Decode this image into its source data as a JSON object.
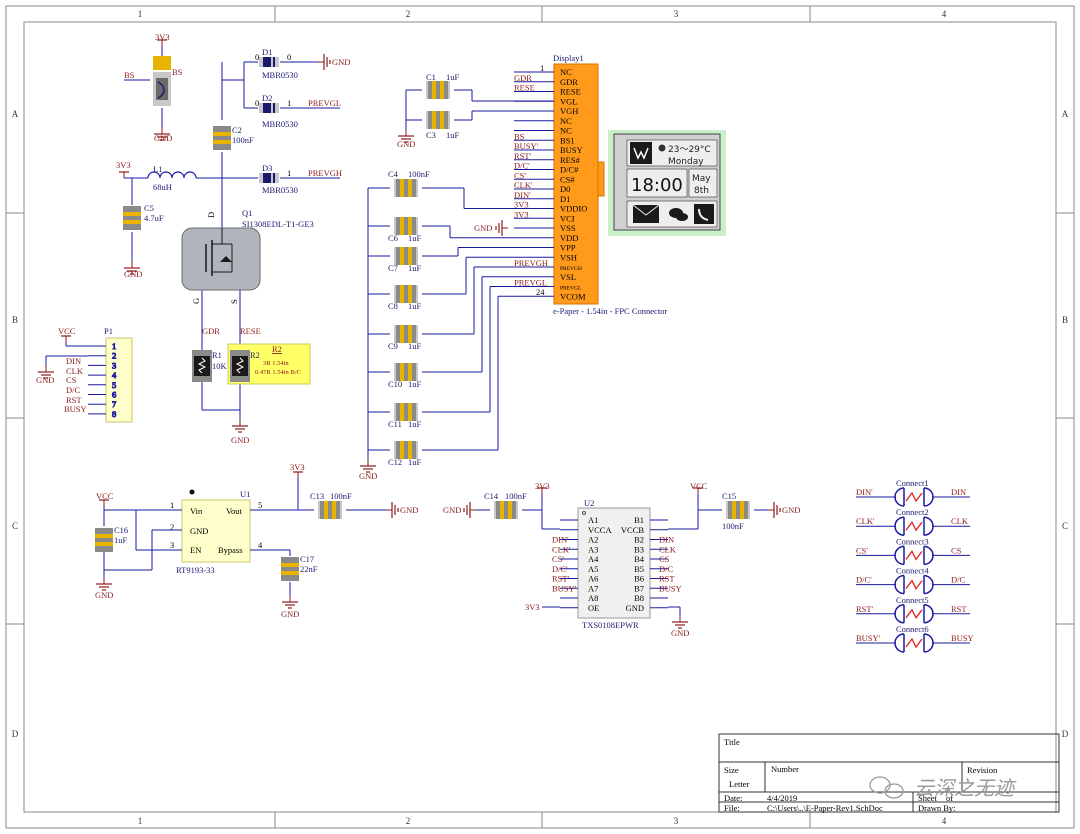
{
  "frame": {
    "cols": [
      "1",
      "2",
      "3",
      "4"
    ],
    "rows": [
      "A",
      "B",
      "C",
      "D"
    ]
  },
  "title_block": {
    "title_label": "Title",
    "size_label": "Size",
    "size_value": "Letter",
    "number_label": "Number",
    "revision_label": "Revision",
    "date_label": "Date:",
    "date_value": "4/4/2019",
    "file_label": "File:",
    "file_value": "C:\\Users\\..\\E-Paper-Rev1.SchDoc",
    "sheet_label": "Sheet",
    "of_label": "of",
    "drawn_label": "Drawn By:"
  },
  "watermark": "云深之无迹",
  "nets": {
    "v3v3": "3V3",
    "gnd": "GND",
    "vcc": "VCC",
    "bs": "BS",
    "prevgl": "PREVGL",
    "prevgh": "PREVGH",
    "gdr": "GDR",
    "rese": "RESE",
    "din": "DIN",
    "clk": "CLK",
    "cs": "CS",
    "dc": "D/C",
    "rst": "RST",
    "busy": "BUSY",
    "din_p": "DIN'",
    "clk_p": "CLK'",
    "cs_p": "CS'",
    "dc_p": "D/C'",
    "rst_p": "RST'",
    "busy_p": "BUSY'"
  },
  "parts": {
    "d1": {
      "ref": "D1",
      "val": "MBR0530"
    },
    "d2": {
      "ref": "D2",
      "val": "MBR0530"
    },
    "d3": {
      "ref": "D3",
      "val": "MBR0530"
    },
    "c2": {
      "ref": "C2",
      "val": "100nF"
    },
    "l1": {
      "ref": "L1",
      "val": "68uH"
    },
    "c5": {
      "ref": "C5",
      "val": "4.7uF"
    },
    "q1": {
      "ref": "Q1",
      "val": "SI1308EDL-T1-GE3",
      "g": "G",
      "s": "S",
      "d": "D"
    },
    "r1": {
      "ref": "R1",
      "val": "10K"
    },
    "r2": {
      "ref": "R2",
      "note1": "3R  1.54in",
      "note2": "0.47R  1.54in B/C"
    },
    "bs_sw": {
      "ref": "BS"
    },
    "p1": {
      "ref": "P1",
      "pins": [
        "1",
        "2",
        "3",
        "4",
        "5",
        "6",
        "7",
        "8"
      ]
    },
    "c1": {
      "ref": "C1",
      "val": "1uF"
    },
    "c3": {
      "ref": "C3",
      "val": "1uF"
    },
    "c4": {
      "ref": "C4",
      "val": "100nF"
    },
    "c6": {
      "ref": "C6",
      "val": "1uF"
    },
    "c7": {
      "ref": "C7",
      "val": "1uF"
    },
    "c8": {
      "ref": "C8",
      "val": "1uF"
    },
    "c9": {
      "ref": "C9",
      "val": "1uF"
    },
    "c10": {
      "ref": "C10",
      "val": "1uF"
    },
    "c11": {
      "ref": "C11",
      "val": "1uF"
    },
    "c12": {
      "ref": "C12",
      "val": "1uF"
    },
    "display": {
      "ref": "Display1",
      "desc": "e-Paper - 1.54in - FPC Connector",
      "pin_first": "1",
      "pin_last": "24",
      "pins": [
        "NC",
        "GDR",
        "RESE",
        "VGL",
        "VGH",
        "NC",
        "NC",
        "BS1",
        "BUSY",
        "RES#",
        "D/C#",
        "CS#",
        "D0",
        "D1",
        "VDDIO",
        "VCI",
        "VSS",
        "VDD",
        "VPP",
        "VSH",
        "PREVGH",
        "VSL",
        "PREVGL",
        "VCOM"
      ],
      "left_labels": [
        "",
        "GDR",
        "RESE",
        "",
        "",
        "",
        "",
        "BS",
        "BUSY'",
        "RST'",
        "D/C'",
        "CS'",
        "CLK'",
        "DIN'",
        "3V3",
        "3V3",
        "",
        "",
        "",
        "",
        "PREVGH",
        "",
        "PREVGL",
        ""
      ]
    },
    "epaper": {
      "temp": "23～29°C",
      "day": "Monday",
      "time": "18:00",
      "month": "May",
      "date": "8th"
    },
    "u1": {
      "ref": "U1",
      "val": "RT9193-33",
      "vin": "Vin",
      "gnd": "GND",
      "en": "EN",
      "vout": "Vout",
      "bypass": "Bypass",
      "p1": "1",
      "p2": "2",
      "p3": "3",
      "p4": "4",
      "p5": "5"
    },
    "c13": {
      "ref": "C13",
      "val": "100nF"
    },
    "c16": {
      "ref": "C16",
      "val": "1uF"
    },
    "c17": {
      "ref": "C17",
      "val": "22nF"
    },
    "c14": {
      "ref": "C14",
      "val": "100nF"
    },
    "c15": {
      "ref": "C15",
      "val": "100nF"
    },
    "u2": {
      "ref": "U2",
      "val": "TXS0108EPWR",
      "left": [
        "A1",
        "VCCA",
        "A2",
        "A3",
        "A4",
        "A5",
        "A6",
        "A7",
        "A8",
        "OE"
      ],
      "right": [
        "B1",
        "VCCB",
        "B2",
        "B3",
        "B4",
        "B5",
        "B6",
        "B7",
        "B8",
        "GND"
      ]
    },
    "connects": [
      {
        "ref": "Connect1",
        "a": "DIN'",
        "b": "DIN"
      },
      {
        "ref": "Connect2",
        "a": "CLK'",
        "b": "CLK"
      },
      {
        "ref": "Connect3",
        "a": "CS'",
        "b": "CS"
      },
      {
        "ref": "Connect4",
        "a": "D/C'",
        "b": "D/C"
      },
      {
        "ref": "Connect5",
        "a": "RST'",
        "b": "RST"
      },
      {
        "ref": "Connect6",
        "a": "BUSY'",
        "b": "BUSY"
      }
    ]
  },
  "colors": {
    "wire": "#1a1aa0",
    "net_label": "#8b1a1a",
    "cap_body": "#e8b400",
    "cap_plate": "#8a8a8a",
    "display_body": "#ff9a1a",
    "q1_body": "#b0b4bc",
    "r2_highlight": "#ffff66",
    "connector_body": "#ffffcc"
  }
}
